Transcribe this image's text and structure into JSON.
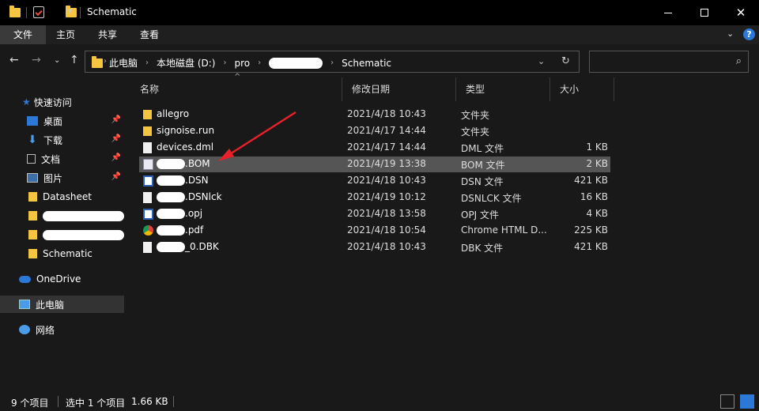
{
  "window": {
    "title": "Schematic"
  },
  "ribbon": {
    "tabs": [
      "文件",
      "主页",
      "共享",
      "查看"
    ],
    "active": "文件"
  },
  "address": {
    "crumbs": [
      "此电脑",
      "本地磁盘 (D:)",
      "pro",
      "Schematic"
    ]
  },
  "columns": {
    "name": "名称",
    "date": "修改日期",
    "type": "类型",
    "size": "大小"
  },
  "sidebar": {
    "quick_access": "快速访问",
    "items": [
      {
        "label": "桌面",
        "icon": "desktop-icon",
        "pinned": true
      },
      {
        "label": "下载",
        "icon": "download-icon",
        "pinned": true
      },
      {
        "label": "文档",
        "icon": "documents-icon",
        "pinned": true
      },
      {
        "label": "图片",
        "icon": "pictures-icon",
        "pinned": true
      },
      {
        "label": "Datasheet",
        "icon": "folder-icon"
      },
      {
        "label": "",
        "icon": "folder-icon",
        "redacted": true
      },
      {
        "label": "",
        "icon": "folder-icon",
        "redacted": true
      },
      {
        "label": "Schematic",
        "icon": "folder-icon"
      }
    ],
    "onedrive": "OneDrive",
    "this_pc": "此电脑",
    "network": "网络"
  },
  "files": [
    {
      "name": "allegro",
      "date": "2021/4/18 10:43",
      "type": "文件夹",
      "size": "",
      "icon": "folder-icon"
    },
    {
      "name": "signoise.run",
      "date": "2021/4/17 14:44",
      "type": "文件夹",
      "size": "",
      "icon": "folder-icon"
    },
    {
      "name": "devices.dml",
      "date": "2021/4/17 14:44",
      "type": "DML 文件",
      "size": "1 KB",
      "icon": "file-icon"
    },
    {
      "name": ".BOM",
      "date": "2021/4/19 13:38",
      "type": "BOM 文件",
      "size": "2 KB",
      "icon": "text-file-icon",
      "selected": true
    },
    {
      "name": ".DSN",
      "date": "2021/4/18 10:43",
      "type": "DSN 文件",
      "size": "421 KB",
      "icon": "orcad-icon"
    },
    {
      "name": ".DSNlck",
      "date": "2021/4/19 10:12",
      "type": "DSNLCK 文件",
      "size": "16 KB",
      "icon": "file-icon"
    },
    {
      "name": ".opj",
      "date": "2021/4/18 13:58",
      "type": "OPJ 文件",
      "size": "4 KB",
      "icon": "orcad-icon"
    },
    {
      "name": ".pdf",
      "date": "2021/4/18 10:54",
      "type": "Chrome HTML D...",
      "size": "225 KB",
      "icon": "chrome-icon"
    },
    {
      "name": "_0.DBK",
      "date": "2021/4/18 10:43",
      "type": "DBK 文件",
      "size": "421 KB",
      "icon": "file-icon"
    }
  ],
  "status": {
    "count": "9 个项目",
    "selected": "选中 1 个项目",
    "size": "1.66 KB"
  },
  "colors": {
    "accent": "#2b78d6",
    "folder": "#f5c542",
    "arrow": "#e8202a"
  }
}
